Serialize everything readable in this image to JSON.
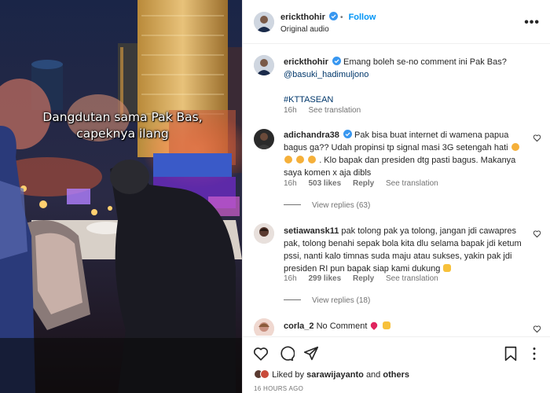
{
  "media": {
    "caption_line1": "Dangdutan sama Pak Bas,",
    "caption_line2": "capeknya ilang"
  },
  "header": {
    "username": "erickthohir",
    "follow_label": "Follow",
    "separator": "•",
    "audio_label": "Original audio",
    "more_label": "•••"
  },
  "post": {
    "username": "erickthohir",
    "caption": "Emang boleh se-no comment ini Pak Bas?",
    "mention": "@basuki_hadimuljono",
    "hashtag": "#KTTASEAN",
    "time": "16h",
    "translation_label": "See translation"
  },
  "comments": [
    {
      "username": "adichandra38",
      "line1": "Pak bisa buat internet di wamena papua",
      "line2": "bagus ga?? Udah propinsi tp signal masi 3G setengah hati",
      "line3_suffix": ". Klo bapak dan presiden dtg pasti bagus. Makanya",
      "line4": "saya komen x aja dibls",
      "time": "16h",
      "likes": "503 likes",
      "reply": "Reply",
      "translation": "See translation",
      "view_replies": "View replies (63)"
    },
    {
      "username": "setiawansk11",
      "line1": "pak tolong pak ya tolong, jangan jdi cawapres",
      "line2": "pak, tolong benahi sepak bola kita dlu selama bapak jdi ketum",
      "line3": "pssi, nanti kalo timnas suda maju atau sukses, yakin pak jdi",
      "line4": "presiden RI pun bapak siap kami dukung",
      "time": "16h",
      "likes": "299 likes",
      "reply": "Reply",
      "translation": "See translation",
      "view_replies": "View replies (18)"
    },
    {
      "username": "corla_2",
      "text": "No Comment"
    }
  ],
  "footer": {
    "liked_prefix": "Liked by",
    "liked_user": "sarawijayanto",
    "liked_and": "and",
    "liked_others": "others",
    "date": "16 HOURS AGO"
  },
  "colors": {
    "accent": "#0095f6",
    "link": "#00376b",
    "muted": "#737373",
    "verified": "#3897f0"
  }
}
